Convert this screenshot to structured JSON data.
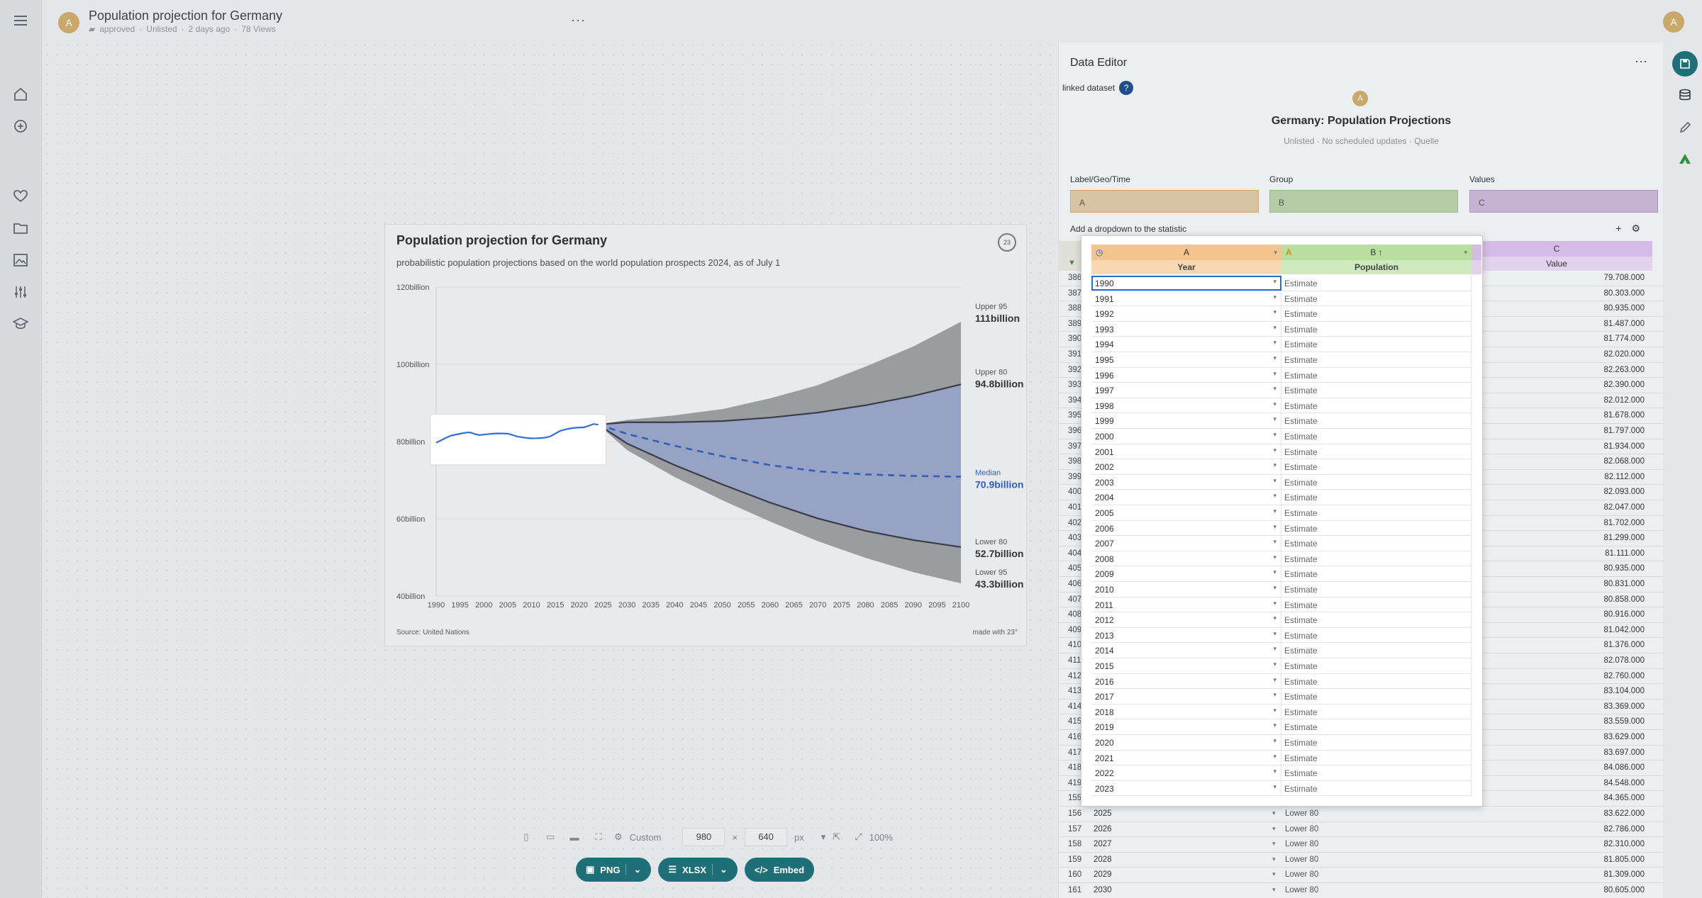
{
  "header": {
    "avatar": "A",
    "title": "Population projection for Germany",
    "folder": "approved",
    "visibility": "Unlisted",
    "updated": "2 days ago",
    "views": "78 Views",
    "more": "···",
    "user_avatar": "A"
  },
  "chart": {
    "title": "Population projection for Germany",
    "subtitle": "probabilistic population projections based on the world population prospects 2024, as of July 1",
    "source": "Source: United Nations",
    "made_with": "made with 23°",
    "logo": "23"
  },
  "chart_data": {
    "type": "area",
    "x_ticks": [
      1990,
      1995,
      2000,
      2005,
      2010,
      2015,
      2020,
      2025,
      2030,
      2035,
      2040,
      2045,
      2050,
      2055,
      2060,
      2065,
      2070,
      2075,
      2080,
      2085,
      2090,
      2095,
      2100
    ],
    "y_ticks": [
      "120billion",
      "100billion",
      "80billion",
      "60billion",
      "40billion"
    ],
    "xlim": [
      1990,
      2100
    ],
    "ylim": [
      40,
      120
    ],
    "estimate": {
      "x": [
        1990,
        1991,
        1992,
        1993,
        1994,
        1995,
        1996,
        1997,
        1998,
        1999,
        2000,
        2001,
        2002,
        2003,
        2004,
        2005,
        2006,
        2007,
        2008,
        2009,
        2010,
        2011,
        2012,
        2013,
        2014,
        2015,
        2016,
        2017,
        2018,
        2019,
        2020,
        2021,
        2022,
        2023,
        2024
      ],
      "y": [
        79.708,
        80.303,
        80.935,
        81.487,
        81.774,
        82.02,
        82.263,
        82.39,
        82.012,
        81.678,
        81.797,
        81.934,
        82.068,
        82.112,
        82.093,
        82.047,
        81.702,
        81.299,
        81.111,
        80.935,
        80.831,
        80.858,
        80.916,
        81.042,
        81.376,
        82.078,
        82.76,
        83.104,
        83.369,
        83.559,
        83.629,
        83.697,
        84.086,
        84.548,
        84.365
      ]
    },
    "projection_x": [
      2024,
      2030,
      2040,
      2050,
      2060,
      2070,
      2080,
      2090,
      2100
    ],
    "series": [
      {
        "name": "Upper 95",
        "value": "111billion",
        "values": [
          84.4,
          85.6,
          86.8,
          88.4,
          91.2,
          94.6,
          99.4,
          104.6,
          111
        ]
      },
      {
        "name": "Upper 80",
        "value": "94.8billion",
        "values": [
          84.4,
          85.0,
          85.0,
          85.3,
          86.2,
          87.5,
          89.4,
          91.8,
          94.8
        ]
      },
      {
        "name": "Median",
        "value": "70.9billion",
        "values": [
          84.4,
          82.0,
          78.9,
          76.2,
          73.9,
          72.3,
          71.5,
          71.1,
          70.9
        ]
      },
      {
        "name": "Lower 80",
        "value": "52.7billion",
        "values": [
          84.4,
          79.5,
          73.9,
          68.9,
          64.2,
          60.1,
          56.9,
          54.5,
          52.7
        ]
      },
      {
        "name": "Lower 95",
        "value": "43.3billion",
        "values": [
          84.4,
          77.8,
          70.8,
          64.8,
          59.3,
          54.2,
          49.9,
          46.2,
          43.3
        ]
      }
    ],
    "colors": {
      "estimate": "#2f6fd6",
      "band95": "#9a9ca0",
      "band80": "#97a3c4",
      "median": "#2f5fb8",
      "bound80": "#3a3d45"
    }
  },
  "toolbar": {
    "preset": "Custom",
    "width": "980",
    "times": "×",
    "height": "640",
    "unit": "px",
    "zoom": "100%",
    "png": "PNG",
    "xlsx": "XLSX",
    "embed": "Embed"
  },
  "editor": {
    "title": "Data Editor",
    "more": "···",
    "linked": "linked dataset",
    "help": "?",
    "dataset_avatar": "A",
    "dataset_name": "Germany: Population Projections",
    "dataset_meta": "Unlisted · No scheduled updates · Quelle",
    "roles": [
      {
        "label": "Label/Geo/Time",
        "value": "A"
      },
      {
        "label": "Group",
        "value": "B"
      },
      {
        "label": "Values",
        "value": "C"
      }
    ],
    "dropdown_label": "Add a dropdown to the statistic",
    "add": "+",
    "colors": {
      "a": "#f3c48c",
      "b": "#b9dfa0",
      "c": "#d5bce6",
      "a_box": "#d8c3a2",
      "b_box": "#b4cda7",
      "c_box": "#c6b3d3"
    }
  },
  "bg_table": {
    "col_c": "C",
    "col_c_name": "Value",
    "rows": [
      {
        "idx": "386",
        "val": "79.708.000"
      },
      {
        "idx": "387",
        "val": "80.303.000"
      },
      {
        "idx": "388",
        "val": "80.935.000"
      },
      {
        "idx": "389",
        "val": "81.487.000"
      },
      {
        "idx": "390",
        "val": "81.774.000"
      },
      {
        "idx": "391",
        "val": "82.020.000"
      },
      {
        "idx": "392",
        "val": "82.263.000"
      },
      {
        "idx": "393",
        "val": "82.390.000"
      },
      {
        "idx": "394",
        "val": "82.012.000"
      },
      {
        "idx": "395",
        "val": "81.678.000"
      },
      {
        "idx": "396",
        "val": "81.797.000"
      },
      {
        "idx": "397",
        "val": "81.934.000"
      },
      {
        "idx": "398",
        "val": "82.068.000"
      },
      {
        "idx": "399",
        "val": "82.112.000"
      },
      {
        "idx": "400",
        "val": "82.093.000"
      },
      {
        "idx": "401",
        "val": "82.047.000"
      },
      {
        "idx": "402",
        "val": "81.702.000"
      },
      {
        "idx": "403",
        "val": "81.299.000"
      },
      {
        "idx": "404",
        "val": "81.111.000"
      },
      {
        "idx": "405",
        "val": "80.935.000"
      },
      {
        "idx": "406",
        "val": "80.831.000"
      },
      {
        "idx": "407",
        "val": "80.858.000"
      },
      {
        "idx": "408",
        "val": "80.916.000"
      },
      {
        "idx": "409",
        "val": "81.042.000"
      },
      {
        "idx": "410",
        "val": "81.376.000"
      },
      {
        "idx": "411",
        "val": "82.078.000"
      },
      {
        "idx": "412",
        "val": "82.760.000"
      },
      {
        "idx": "413",
        "val": "83.104.000"
      },
      {
        "idx": "414",
        "val": "83.369.000"
      },
      {
        "idx": "415",
        "val": "83.559.000"
      },
      {
        "idx": "416",
        "val": "83.629.000"
      },
      {
        "idx": "417",
        "val": "83.697.000"
      },
      {
        "idx": "418",
        "val": "84.086.000"
      },
      {
        "idx": "419",
        "val": "84.548.000"
      },
      {
        "idx": "155",
        "val": "84.365.000"
      },
      {
        "idx": "156",
        "year": "2025",
        "group": "Lower 80",
        "val": "83.622.000"
      },
      {
        "idx": "157",
        "year": "2026",
        "group": "Lower 80",
        "val": "82.786.000"
      },
      {
        "idx": "158",
        "year": "2027",
        "group": "Lower 80",
        "val": "82.310.000"
      },
      {
        "idx": "159",
        "year": "2028",
        "group": "Lower 80",
        "val": "81.805.000"
      },
      {
        "idx": "160",
        "year": "2029",
        "group": "Lower 80",
        "val": "81.309.000"
      },
      {
        "idx": "161",
        "year": "2030",
        "group": "Lower 80",
        "val": "80.605.000"
      }
    ]
  },
  "popup": {
    "col_a": "A",
    "col_a_name": "Year",
    "col_b": "B ↑",
    "col_b_name": "Population",
    "rows": [
      {
        "year": "1990",
        "group": "Estimate"
      },
      {
        "year": "1991",
        "group": "Estimate"
      },
      {
        "year": "1992",
        "group": "Estimate"
      },
      {
        "year": "1993",
        "group": "Estimate"
      },
      {
        "year": "1994",
        "group": "Estimate"
      },
      {
        "year": "1995",
        "group": "Estimate"
      },
      {
        "year": "1996",
        "group": "Estimate"
      },
      {
        "year": "1997",
        "group": "Estimate"
      },
      {
        "year": "1998",
        "group": "Estimate"
      },
      {
        "year": "1999",
        "group": "Estimate"
      },
      {
        "year": "2000",
        "group": "Estimate"
      },
      {
        "year": "2001",
        "group": "Estimate"
      },
      {
        "year": "2002",
        "group": "Estimate"
      },
      {
        "year": "2003",
        "group": "Estimate"
      },
      {
        "year": "2004",
        "group": "Estimate"
      },
      {
        "year": "2005",
        "group": "Estimate"
      },
      {
        "year": "2006",
        "group": "Estimate"
      },
      {
        "year": "2007",
        "group": "Estimate"
      },
      {
        "year": "2008",
        "group": "Estimate"
      },
      {
        "year": "2009",
        "group": "Estimate"
      },
      {
        "year": "2010",
        "group": "Estimate"
      },
      {
        "year": "2011",
        "group": "Estimate"
      },
      {
        "year": "2012",
        "group": "Estimate"
      },
      {
        "year": "2013",
        "group": "Estimate"
      },
      {
        "year": "2014",
        "group": "Estimate"
      },
      {
        "year": "2015",
        "group": "Estimate"
      },
      {
        "year": "2016",
        "group": "Estimate"
      },
      {
        "year": "2017",
        "group": "Estimate"
      },
      {
        "year": "2018",
        "group": "Estimate"
      },
      {
        "year": "2019",
        "group": "Estimate"
      },
      {
        "year": "2020",
        "group": "Estimate"
      },
      {
        "year": "2021",
        "group": "Estimate"
      },
      {
        "year": "2022",
        "group": "Estimate"
      },
      {
        "year": "2023",
        "group": "Estimate"
      }
    ]
  }
}
